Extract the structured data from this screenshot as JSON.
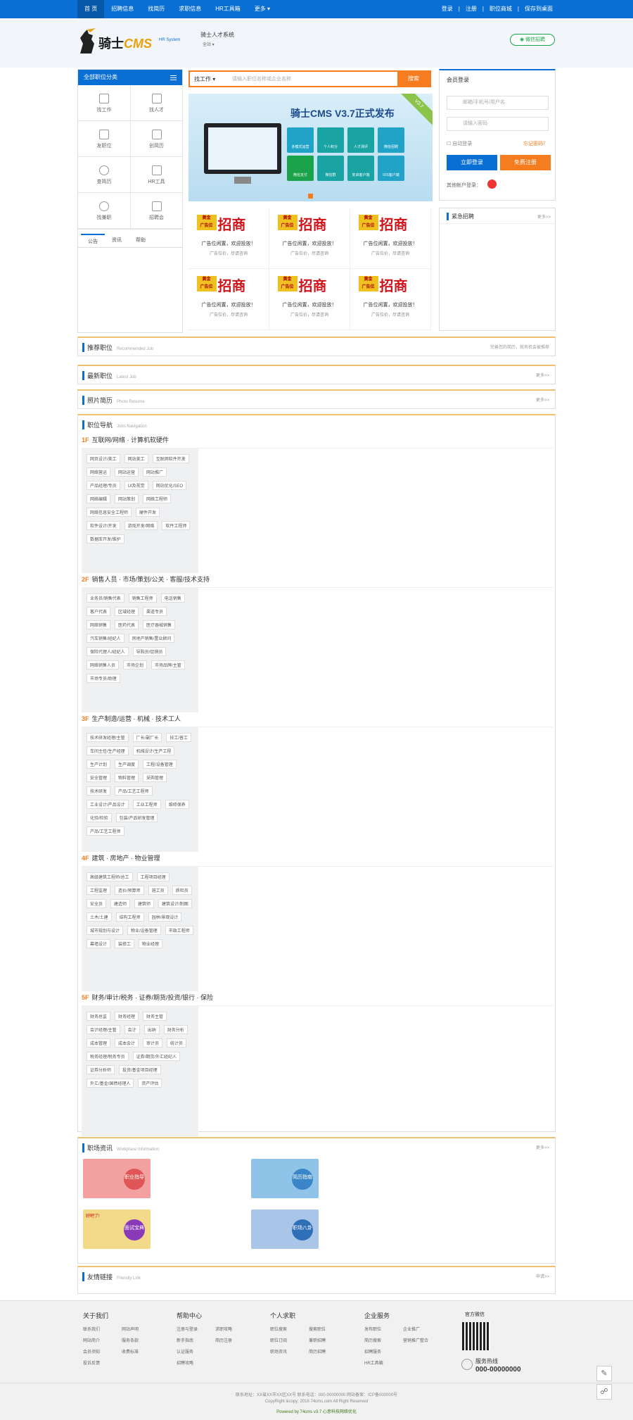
{
  "topnav": {
    "items": [
      "首 页",
      "招聘信息",
      "找简历",
      "求职信息",
      "HR工具箱",
      "更多 ▾"
    ],
    "right": [
      "登录",
      "|",
      "注册",
      "|",
      "职位商城",
      "|",
      "保存到桌面"
    ]
  },
  "header": {
    "logo": "骑士",
    "logo_cms": "CMS",
    "logo_sub": "HR System",
    "site_name": "骑士人才系统",
    "city": "全站 ▾",
    "wechat": "微信招聘"
  },
  "category": {
    "title": "全部职位分类",
    "cells": [
      "找工作",
      "找人才",
      "发职位",
      "创简历",
      "查简历",
      "HR工具",
      "找兼职",
      "招聘会"
    ],
    "tabs": [
      "公告",
      "资讯",
      "帮助"
    ]
  },
  "search": {
    "select": "找工作 ▾",
    "placeholder": "请输入职位名称或企业名称",
    "button": "搜索"
  },
  "banner": {
    "title": "骑士CMS V3.7正式发布",
    "corner": "V3.7",
    "icons": [
      "多模式运营",
      "个人积分",
      "人才测评",
      "微信招聘",
      "微信支付",
      "微信群",
      "安卓客户端",
      "IOS客户端"
    ]
  },
  "ads": [
    {
      "label": "广告位",
      "line1": "广告位闲置，欢迎投放！",
      "line2": "广告位价，尽请咨询"
    },
    {
      "label": "广告位",
      "line1": "广告位闲置，欢迎投放！",
      "line2": "广告位价，尽请咨询"
    },
    {
      "label": "广告位",
      "line1": "广告位闲置，欢迎投放！",
      "line2": "广告位价，尽请咨询"
    },
    {
      "label": "广告位",
      "line1": "广告位闲置，欢迎投放！",
      "line2": "广告位价，尽请咨询"
    },
    {
      "label": "广告位",
      "line1": "广告位闲置，欢迎投放！",
      "line2": "广告位价，尽请咨询"
    },
    {
      "label": "广告位",
      "line1": "广告位闲置，欢迎投放！",
      "line2": "广告位价，尽请咨询"
    }
  ],
  "ad_big": "招商",
  "ad_tag": "黄金",
  "login": {
    "title": "会员登录",
    "user_ph": "邮箱/手机号/用户名",
    "pass_ph": "请输入密码",
    "remember": "自动登录",
    "forgot": "忘记密码？",
    "login_btn": "立即登录",
    "register_btn": "免费注册",
    "other": "其他帐户登录："
  },
  "urgent": {
    "title": "紧急招聘",
    "more": "更多>>"
  },
  "sections": {
    "recommend": {
      "title": "推荐职位",
      "en": "Recommended Job",
      "more": "完善您的简历，就有机会被推荐"
    },
    "latest": {
      "title": "最新职位",
      "en": "Latest Job",
      "more": "更多>>"
    },
    "photo": {
      "title": "照片简历",
      "en": "Photo Resume",
      "more": "更多>>"
    },
    "guide": {
      "title": "职位导航",
      "en": "Jobs Navigation"
    },
    "workplace": {
      "title": "职场资讯",
      "en": "Workplace Information",
      "more": "更多>>"
    },
    "links": {
      "title": "友情链接",
      "en": "Friendly Link",
      "more": "申请>>"
    }
  },
  "floors": [
    {
      "no": "1F",
      "title": "互联网/网络 · 计算机软硬件",
      "tags": [
        "网页设计/美工",
        "网站美工",
        "互联网软件开发",
        "网络营运",
        "网站运营",
        "网站推广",
        "产品经理/专员",
        "UI及视觉",
        "网站优化/SEO",
        "网络编辑",
        "网站策划",
        "网络工程师",
        "网络信息安全工程师",
        "硬件开发",
        "软件设计/开发",
        "游戏开发/网络",
        "软件工程师",
        "数据库开发/维护"
      ]
    },
    {
      "no": "2F",
      "title": "销售人员 · 市场/策划/公关 · 客服/技术支持",
      "tags": [
        "业务员/销售代表",
        "销售工程师",
        "电话销售",
        "客户代表",
        "区域经理",
        "渠道专员",
        "网络销售",
        "医药代表",
        "医疗器械销售",
        "汽车销售/经纪人",
        "房地产销售/置业顾问",
        "保险代理人/经纪人",
        "导购员/促销员",
        "网络销售人员",
        "市场企划",
        "市场品牌/主管",
        "市场专员/助理"
      ]
    },
    {
      "no": "3F",
      "title": "生产制造/运营 · 机械 · 技术工人",
      "tags": [
        "技术研发经理/主管",
        "厂长/副厂长",
        "技工/普工",
        "车间主任/生产经理",
        "机械设计/生产工程",
        "生产计划",
        "生产调度",
        "工程/设备管理",
        "安全管理",
        "物料管理",
        "采购管理",
        "技术研发",
        "产品/工艺工程师",
        "工业设计/产品设计",
        "工业工程师",
        "维修保养",
        "化验/检验",
        "包装/产品研发管理",
        "产品/工艺工程师"
      ]
    },
    {
      "no": "4F",
      "title": "建筑 · 房地产 · 物业管理",
      "tags": [
        "高级建筑工程师/总工",
        "工程项目经理",
        "工程监理",
        "造价/预算师",
        "施工员",
        "质检员",
        "安全员",
        "建造师",
        "建筑师",
        "建筑设计/制图",
        "土木/土建",
        "结构工程师",
        "园林/景观设计",
        "城市规划与设计",
        "物业/设备管理",
        "市政工程师",
        "幕墙设计",
        "装修工",
        "物业经理"
      ]
    },
    {
      "no": "5F",
      "title": "财务/审计/税务 · 证券/期货/投资/银行 · 保险",
      "tags": [
        "财务总监",
        "财务经理",
        "财务主管",
        "会计经理/主管",
        "会计",
        "出纳",
        "财务分析",
        "成本管理",
        "成本会计",
        "审计员",
        "统计员",
        "税务经理/税务专员",
        "证券/期货/外汇经纪人",
        "证券分析师",
        "投资/基金项目经理",
        "外汇/基金/国债经理人",
        "资产评估"
      ]
    }
  ],
  "workplace": {
    "items": [
      "职业指导",
      "简历指南",
      "面试宝典",
      "职场八卦"
    ],
    "badge": "好吧了!"
  },
  "footer": {
    "cols": [
      {
        "title": "关于我们",
        "links": [
          "联系我们",
          "网站声明",
          "网站简介",
          "服务条款",
          "会员须知",
          "收费标准",
          "投诉反馈",
          ""
        ]
      },
      {
        "title": "帮助中心",
        "links": [
          "注册与登录",
          "求职攻略",
          "新手指南",
          "简历注册",
          "认证服务",
          "",
          "招聘攻略",
          ""
        ]
      },
      {
        "title": "个人求职",
        "links": [
          "职位搜索",
          "搜索职位",
          "职位订阅",
          "兼职招聘",
          "职场资讯",
          "简历招聘",
          "",
          ""
        ]
      },
      {
        "title": "企业服务",
        "links": [
          "发布职位",
          "企业推广",
          "简历搜索",
          "营销推广整合",
          "招聘服务",
          "",
          "HR工具箱",
          ""
        ]
      }
    ],
    "wechat": "官方微信",
    "hotline_label": "服务热线",
    "hotline": "000-00000000",
    "copy1": "联系地址：XX省XX市XX区XX号 联系电话：000-00000000 网站备案：ICP备000000号",
    "copy2": "CopyRight &copy; 2016 74cms.com All Right Reserved",
    "copy3": "Powered by 74cms v3.7 心意科技网络优化"
  },
  "colors": {
    "primary": "#0a6fd4",
    "accent": "#f57c1f",
    "green": "#1aa34a"
  }
}
